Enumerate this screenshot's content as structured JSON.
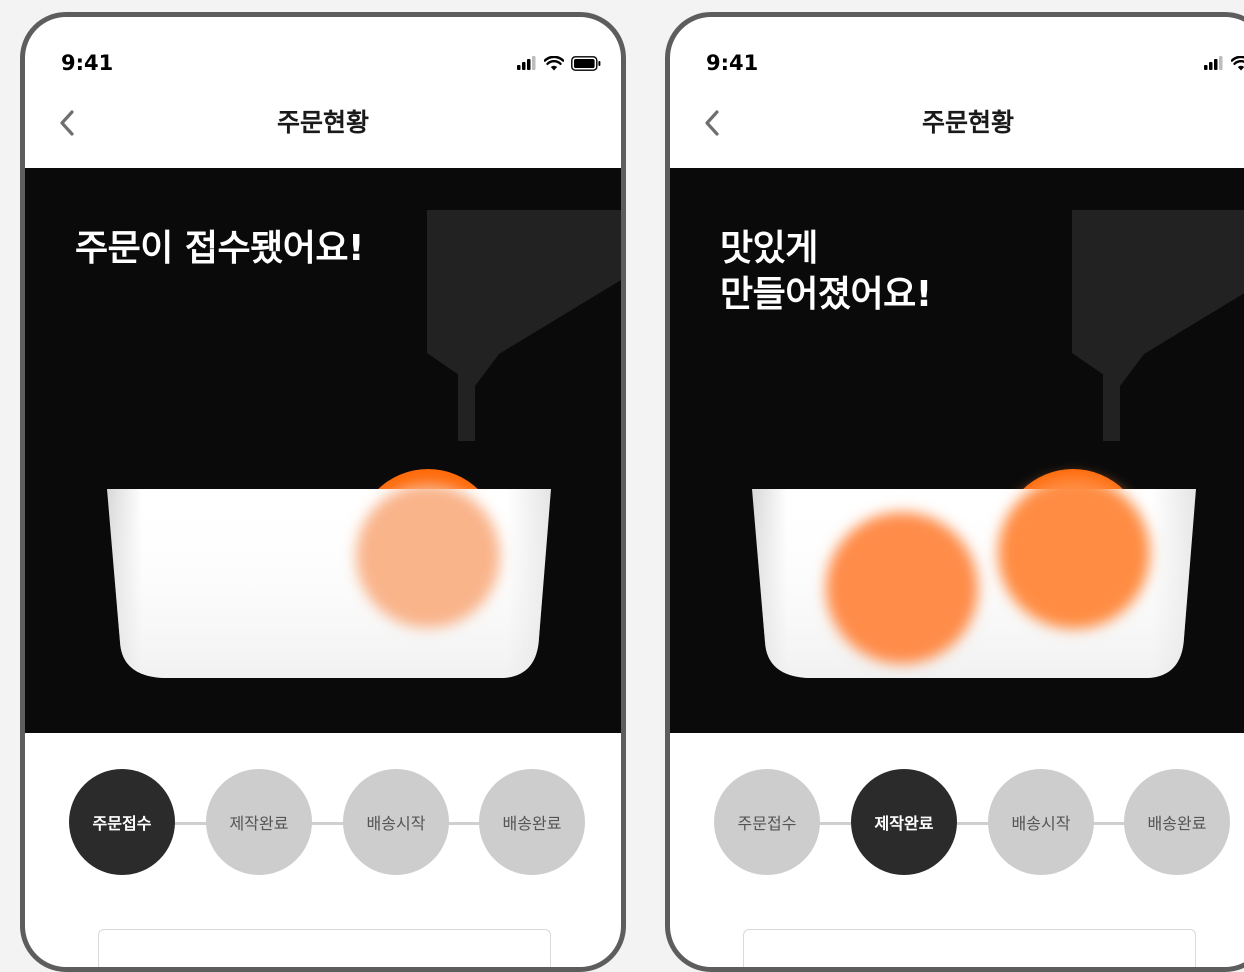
{
  "colors": {
    "phone_frame": "#5d5d5d",
    "hero_background": "#0a0a0a",
    "machine_gray": "#222222",
    "orange_ball": "#ff6a0a",
    "step_active": "#2b2b2b",
    "step_inactive": "#cdcdcd"
  },
  "screens": [
    {
      "status_bar": {
        "time": "9:41",
        "icons": [
          "signal-icon",
          "wifi-icon",
          "battery-icon"
        ]
      },
      "nav": {
        "back_icon": "chevron-left-icon",
        "title": "주문현황"
      },
      "hero": {
        "headline": "주문이 접수됐어요!"
      },
      "steps": [
        {
          "label": "주문접수",
          "active": true
        },
        {
          "label": "제작완료",
          "active": false
        },
        {
          "label": "배송시작",
          "active": false
        },
        {
          "label": "배송완료",
          "active": false
        }
      ]
    },
    {
      "status_bar": {
        "time": "9:41",
        "icons": [
          "signal-icon",
          "wifi-icon",
          "battery-icon"
        ]
      },
      "nav": {
        "back_icon": "chevron-left-icon",
        "title": "주문현황"
      },
      "hero": {
        "headline": "맛있게\n만들어졌어요!"
      },
      "steps": [
        {
          "label": "주문접수",
          "active": false
        },
        {
          "label": "제작완료",
          "active": true
        },
        {
          "label": "배송시작",
          "active": false
        },
        {
          "label": "배송완료",
          "active": false
        }
      ]
    }
  ]
}
